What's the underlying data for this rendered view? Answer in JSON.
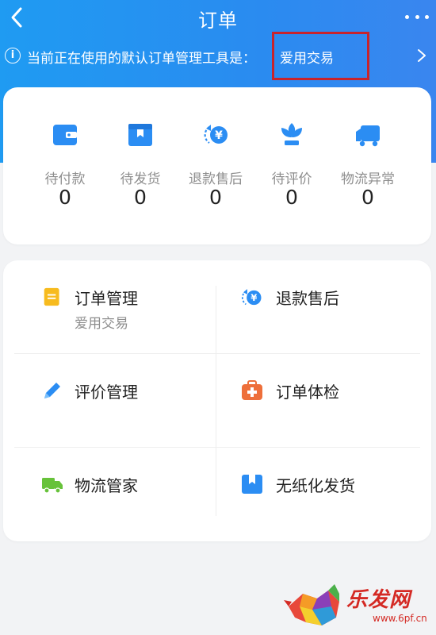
{
  "header": {
    "title": "订单",
    "back_icon": "chevron-left-icon",
    "more_icon": "more-dots-icon"
  },
  "notice": {
    "text": "当前正在使用的默认订单管理工具是：",
    "value": "爱用交易",
    "info_icon": "info-icon",
    "arrow_icon": "chevron-right-icon"
  },
  "order_status": [
    {
      "icon": "wallet-icon",
      "label": "待付款",
      "count": "0"
    },
    {
      "icon": "package-box-icon",
      "label": "待发货",
      "count": "0"
    },
    {
      "icon": "refund-yen-icon",
      "label": "退款售后",
      "count": "0"
    },
    {
      "icon": "flower-review-icon",
      "label": "待评价",
      "count": "0"
    },
    {
      "icon": "truck-exception-icon",
      "label": "物流异常",
      "count": "0"
    }
  ],
  "tools": [
    {
      "icon": "order-list-icon",
      "label": "订单管理",
      "sublabel": "爱用交易"
    },
    {
      "icon": "refund-yen-icon",
      "label": "退款售后",
      "sublabel": ""
    },
    {
      "icon": "pencil-icon",
      "label": "评价管理",
      "sublabel": ""
    },
    {
      "icon": "medical-kit-icon",
      "label": "订单体检",
      "sublabel": ""
    },
    {
      "icon": "truck-icon",
      "label": "物流管家",
      "sublabel": ""
    },
    {
      "icon": "paperless-bookmark-icon",
      "label": "无纸化发货",
      "sublabel": ""
    }
  ],
  "watermark": {
    "logo": "乐发网",
    "url": "www.6pf.cn"
  },
  "colors": {
    "header_blue": "#2a8bf0",
    "icon_blue": "#2b8df3",
    "yellow": "#f7bb1e",
    "orange": "#ee6f3a",
    "green": "#67c23a",
    "highlight_red": "#c8232c"
  }
}
